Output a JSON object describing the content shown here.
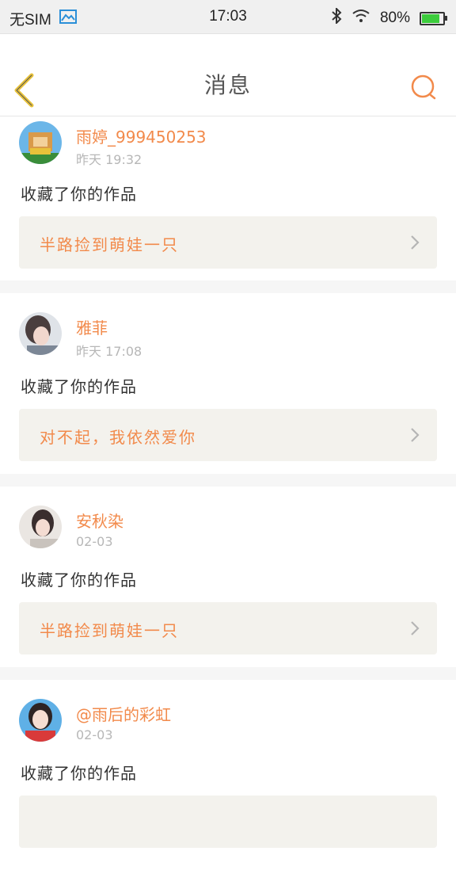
{
  "status_bar": {
    "carrier": "无SIM",
    "time": "17:03",
    "battery": "80%",
    "battery_level": 0.8,
    "icons": [
      "image-icon",
      "bluetooth-icon",
      "wifi-icon",
      "battery-icon"
    ]
  },
  "header": {
    "title": "消息",
    "back_icon": "chevron-left-icon",
    "search_icon": "search-icon"
  },
  "colors": {
    "accent": "#f28a4b",
    "back_arrow": "#e8c23a",
    "card_bg": "#ffffff",
    "work_bg": "#f3f2ed",
    "page_bg": "#f6f6f6"
  },
  "messages": [
    {
      "user": "雨婷_999450253",
      "time": "昨天 19:32",
      "action": "收藏了你的作品",
      "work": "半路捡到萌娃一只"
    },
    {
      "user": "雅菲",
      "time": "昨天 17:08",
      "action": "收藏了你的作品",
      "work": "对不起，我依然爱你"
    },
    {
      "user": "安秋染",
      "time": "02-03",
      "action": "收藏了你的作品",
      "work": "半路捡到萌娃一只"
    },
    {
      "user": "@雨后的彩虹",
      "time": "02-03",
      "action": "收藏了你的作品",
      "work": ""
    }
  ]
}
